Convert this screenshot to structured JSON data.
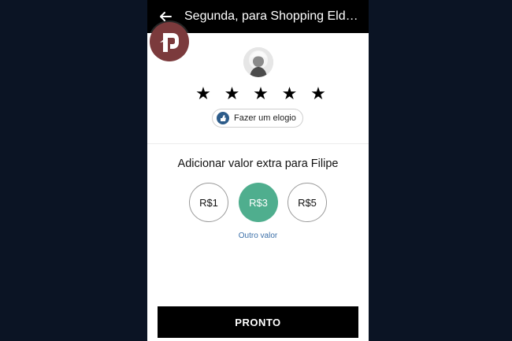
{
  "header": {
    "back_icon": "arrow-left-icon",
    "title": "Segunda, para Shopping Eldor..."
  },
  "driver": {
    "avatar_icon": "driver-avatar"
  },
  "rating": {
    "stars": [
      "★",
      "★",
      "★",
      "★",
      "★"
    ],
    "value_of_5": 5
  },
  "compliment": {
    "icon": "compliment-icon",
    "label": "Fazer um elogio"
  },
  "tip": {
    "title": "Adicionar valor extra para Filipe",
    "options": [
      {
        "label": "R$1",
        "selected": false
      },
      {
        "label": "R$3",
        "selected": true
      },
      {
        "label": "R$5",
        "selected": false
      }
    ],
    "other_label": "Outro valor",
    "selected_color": "#4fae8e"
  },
  "footer": {
    "done_label": "PRONTO"
  },
  "watermark": {
    "icon": "logo-icon",
    "color": "#7b3a3c"
  }
}
